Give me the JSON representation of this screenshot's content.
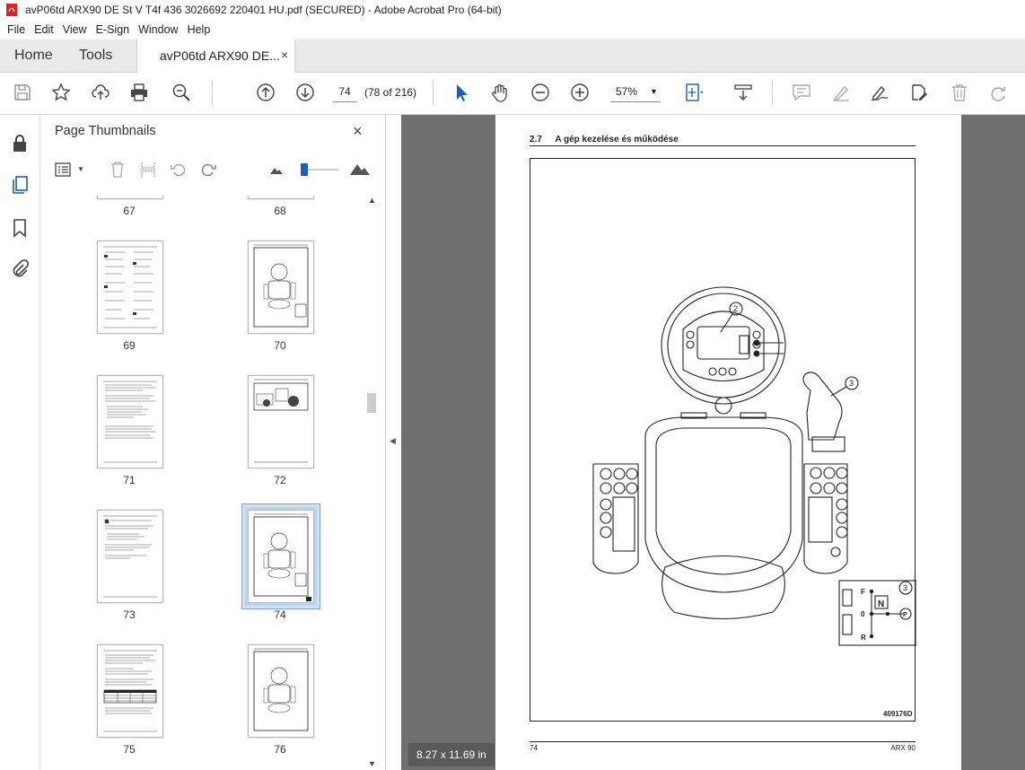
{
  "window": {
    "title": "avP06td ARX90 DE St V T4f 436 3026692 220401 HU.pdf (SECURED) - Adobe Acrobat Pro (64-bit)"
  },
  "menu": [
    "File",
    "Edit",
    "View",
    "E-Sign",
    "Window",
    "Help"
  ],
  "tabs": {
    "home": "Home",
    "tools": "Tools",
    "document": "avP06td ARX90 DE...",
    "close": "×"
  },
  "toolbar": {
    "page_number": "74",
    "page_of": "(78 of 216)",
    "zoom": "57%",
    "icons": [
      "save-icon",
      "bookmark-star-icon",
      "upload-icon",
      "print-icon",
      "zoom-search-icon",
      "prev-page-icon",
      "next-page-icon",
      "select-cursor-icon",
      "hand-icon",
      "zoom-out-icon",
      "zoom-in-icon",
      "fit-page-icon",
      "scroll-mode-icon",
      "comment-icon",
      "highlight-icon",
      "sign-icon",
      "edit-icon",
      "delete-icon",
      "redo-icon"
    ]
  },
  "left_rail": {
    "icons": [
      "lock-icon",
      "page-thumbnails-icon",
      "bookmarks-icon",
      "attachments-icon"
    ]
  },
  "thumbnails_panel": {
    "title": "Page Thumbnails",
    "close": "×",
    "thumbnails": [
      {
        "label": "67"
      },
      {
        "label": "68"
      },
      {
        "label": "69"
      },
      {
        "label": "70"
      },
      {
        "label": "71"
      },
      {
        "label": "72"
      },
      {
        "label": "73"
      },
      {
        "label": "74"
      },
      {
        "label": "75"
      },
      {
        "label": "76"
      }
    ],
    "selected": "74"
  },
  "document": {
    "size_badge": "8.27 x 11.69 in",
    "page": {
      "section_number": "2.7",
      "section_title": "A gép kezelése és működése",
      "figure_code": "409176D",
      "callouts": [
        "2",
        "3",
        "3"
      ],
      "gear_labels": {
        "forward": "F",
        "neutral": "N",
        "zero": "0",
        "reverse": "R",
        "park": "P"
      },
      "footer_page": "74",
      "footer_model": "ARX 90"
    }
  }
}
